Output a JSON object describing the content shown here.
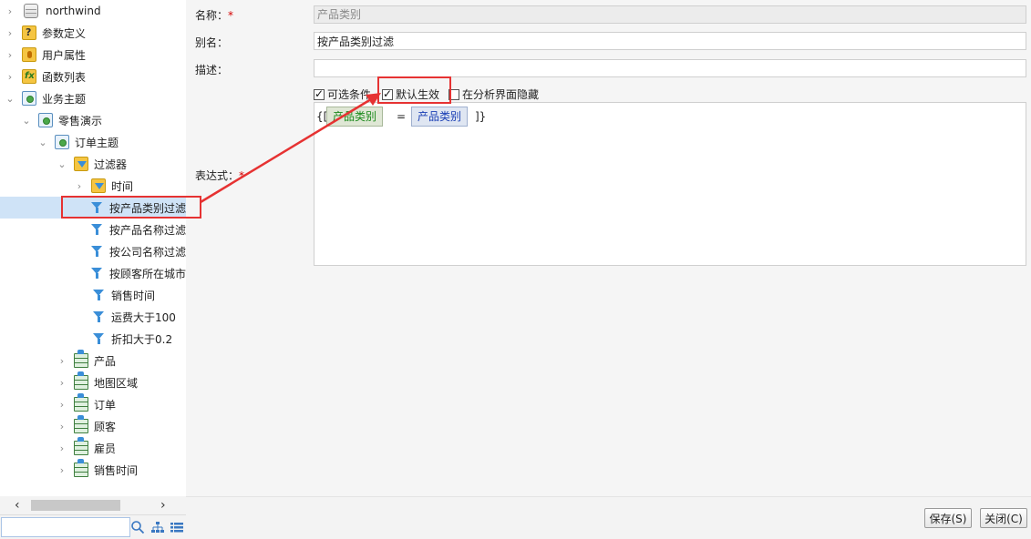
{
  "tree": {
    "items": [
      {
        "label": "northwind",
        "icon": "database-icon",
        "chevron": "right"
      },
      {
        "label": "参数定义",
        "icon": "parameter-icon",
        "chevron": "right"
      },
      {
        "label": "用户属性",
        "icon": "user-attribute-icon",
        "chevron": "right"
      },
      {
        "label": "函数列表",
        "icon": "function-icon",
        "chevron": "right"
      },
      {
        "label": "业务主题",
        "icon": "business-theme-icon",
        "chevron": "down"
      },
      {
        "label": "零售演示",
        "icon": "business-theme-icon",
        "chevron": "down"
      },
      {
        "label": "订单主题",
        "icon": "business-theme-icon",
        "chevron": "down"
      },
      {
        "label": "过滤器",
        "icon": "filter-folder-icon",
        "chevron": "down"
      },
      {
        "label": "时间",
        "icon": "filter-folder-icon",
        "chevron": "right"
      },
      {
        "label": "按产品类别过滤",
        "icon": "filter-icon",
        "chevron": "",
        "selected": true
      },
      {
        "label": "按产品名称过滤",
        "icon": "filter-icon",
        "chevron": ""
      },
      {
        "label": "按公司名称过滤",
        "icon": "filter-icon",
        "chevron": ""
      },
      {
        "label": "按顾客所在城市",
        "icon": "filter-icon",
        "chevron": ""
      },
      {
        "label": "销售时间",
        "icon": "filter-icon",
        "chevron": ""
      },
      {
        "label": "运费大于100",
        "icon": "filter-icon",
        "chevron": ""
      },
      {
        "label": "折扣大于0.2",
        "icon": "filter-icon",
        "chevron": ""
      },
      {
        "label": "产品",
        "icon": "table-icon",
        "chevron": "right"
      },
      {
        "label": "地图区域",
        "icon": "table-icon",
        "chevron": "right"
      },
      {
        "label": "订单",
        "icon": "table-icon",
        "chevron": "right"
      },
      {
        "label": "顾客",
        "icon": "table-icon",
        "chevron": "right"
      },
      {
        "label": "雇员",
        "icon": "table-icon",
        "chevron": "right"
      },
      {
        "label": "销售时间",
        "icon": "table-icon",
        "chevron": "right"
      }
    ],
    "search_value": "",
    "search_icon": "search-icon",
    "tree_view_icon": "tree-view-icon",
    "list_view_icon": "list-view-icon"
  },
  "form": {
    "name_label": "名称：",
    "name_required": "*",
    "name_value": "产品类别",
    "alias_label": "别名：",
    "alias_value": "按产品类别过滤",
    "desc_label": "描述：",
    "desc_value": "",
    "checkboxes": [
      {
        "label": "可选条件",
        "checked": true
      },
      {
        "label": "默认生效",
        "checked": true
      },
      {
        "label": "在分析界面隐藏",
        "checked": false
      }
    ],
    "expr_label": "表达式：",
    "expr_required": "*",
    "expression": {
      "open": "{[",
      "field": "产品类别",
      "operator": "=",
      "param": "产品类别",
      "close": "]}"
    }
  },
  "buttons": {
    "save": "保存(S)",
    "close": "关闭(C)"
  },
  "colors": {
    "selection": "#cfe3f7",
    "annotation": "#e63232",
    "field_green": "#1c8a1c",
    "param_blue": "#1a3fb5"
  }
}
